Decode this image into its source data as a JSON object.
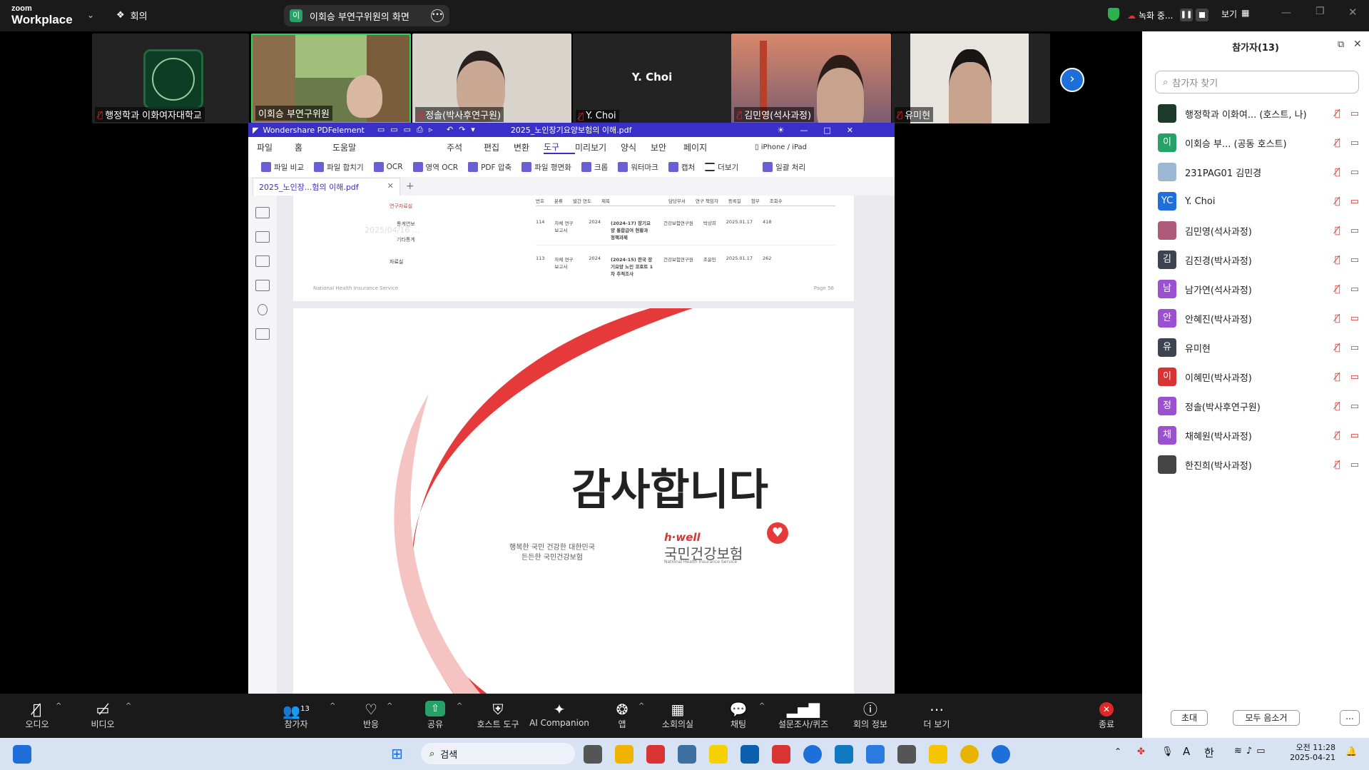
{
  "zoom": {
    "logo_small": "zoom",
    "logo_big": "Workplace",
    "meeting_label": "회의",
    "share_badge": "이",
    "share_title": "이회승 부연구위원의 화면",
    "recording": "녹화 중...",
    "view_label": "보기"
  },
  "gallery": [
    {
      "name": "행정학과 이화여자대학교"
    },
    {
      "name": "이회승 부연구위원"
    },
    {
      "name": "정솔(박사후연구원)"
    },
    {
      "name": "Y. Choi",
      "center_text": "Y. Choi"
    },
    {
      "name": "김민영(석사과정)"
    },
    {
      "name": "유미현"
    }
  ],
  "pdf": {
    "app_name": "Wondershare PDFelement",
    "doc_title": "2025_노인장기요양보험의 이해.pdf",
    "menu": [
      "파일",
      "홈",
      "도움말",
      "주석",
      "편집",
      "변환",
      "도구",
      "미리보기",
      "양식",
      "보안",
      "페이지"
    ],
    "active_menu": "도구",
    "device_label": "iPhone / iPad",
    "tools": [
      "파일 비교",
      "파일 합치기",
      "OCR",
      "영역 OCR",
      "PDF 압축",
      "파일 평면화",
      "크롭",
      "워터마크",
      "캡처",
      "더보기",
      "일괄 처리"
    ],
    "tab_label": "2025_노인장...험의 이해.pdf",
    "page_footer_left": "National Health Insurance Service",
    "page_footer_right": "Page 56",
    "left_nav": [
      "연구자료실",
      "통계연보",
      "기타통계",
      "자료실"
    ],
    "table_headers": [
      "번호",
      "분류",
      "발간 연도",
      "제목",
      "담당부서",
      "연구 책임자",
      "등록일",
      "첨부",
      "조회수"
    ],
    "table_rows": [
      [
        "114",
        "자체 연구 보고서",
        "2024",
        "(2024-17) 장기요양 통합급여 현황과 정책과제",
        "건강보험연구원",
        "박상희",
        "2025.01.17",
        "418"
      ],
      [
        "113",
        "자체 연구 보고서",
        "2024",
        "(2024-15) 한국 장기요양 노인 코호트 1차 추적조사",
        "건강보험연구원",
        "조윤민",
        "2025.01.17",
        "262"
      ]
    ],
    "watermark": "2025/04/16 ...",
    "thanks": "감사합니다",
    "slogan_line1": "행복한 국민 건강한 대한민국",
    "slogan_line2": "든든한 국민건강보험",
    "brand_small": "h·well",
    "brand_big": "국민건강보험",
    "brand_en": "National Health Insurance Service"
  },
  "panel": {
    "title": "참가자(13)",
    "search_placeholder": "참가자 찾기",
    "participants": [
      {
        "name": "행정학과 이화여... (호스트, 나)",
        "avatar": "",
        "color": "#1d3b2a"
      },
      {
        "name": "이회승 부... (공동 호스트)",
        "avatar": "이",
        "color": "#26a269"
      },
      {
        "name": "231PAG01 김민경",
        "avatar": "",
        "color": "#9bb7d4"
      },
      {
        "name": "Y. Choi",
        "avatar": "YC",
        "color": "#1e6fd9"
      },
      {
        "name": "김민영(석사과정)",
        "avatar": "",
        "color": "#b05a7a"
      },
      {
        "name": "김진경(박사과정)",
        "avatar": "김",
        "color": "#3d4450"
      },
      {
        "name": "남가연(석사과정)",
        "avatar": "남",
        "color": "#9b4fd1"
      },
      {
        "name": "안혜진(박사과정)",
        "avatar": "안",
        "color": "#9b4fd1"
      },
      {
        "name": "유미현",
        "avatar": "유",
        "color": "#3d4450"
      },
      {
        "name": "이혜민(박사과정)",
        "avatar": "이",
        "color": "#d83434"
      },
      {
        "name": "정솔(박사후연구원)",
        "avatar": "정",
        "color": "#9b4fd1"
      },
      {
        "name": "채혜원(박사과정)",
        "avatar": "채",
        "color": "#9b4fd1"
      },
      {
        "name": "한진희(박사과정)",
        "avatar": "",
        "color": "#444"
      }
    ],
    "invite": "초대",
    "mute_all": "모두 음소거",
    "more": "..."
  },
  "toolbar": {
    "audio": "오디오",
    "video": "비디오",
    "participants": "참가자",
    "participants_count": "13",
    "reactions": "반응",
    "share": "공유",
    "host_tools": "호스트 도구",
    "ai": "AI Companion",
    "apps": "앱",
    "breakout": "소회의실",
    "chat": "채팅",
    "polls": "설문조사/퀴즈",
    "info": "회의 정보",
    "more": "더 보기",
    "end": "종료"
  },
  "taskbar": {
    "search": "검색",
    "time": "오전 11:28",
    "date": "2025-04-21",
    "ime": "한",
    "ime_a": "A"
  }
}
